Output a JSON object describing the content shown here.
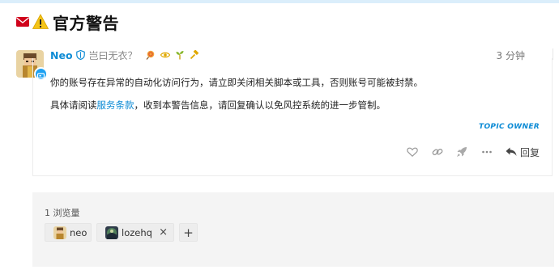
{
  "topic": {
    "title": "官方警告"
  },
  "post": {
    "username": "Neo",
    "user_title": "岂曰无衣？",
    "time": "3 分钟",
    "paragraph1": "你的账号存在异常的自动化访问行为，请立即关闭相关脚本或工具，否则账号可能被封禁。",
    "paragraph2_before": "具体请阅读",
    "tos_link": "服务条款",
    "paragraph2_after": "，收到本警告信息，请回复确认以免风控系统的进一步管制。",
    "owner_badge": "TOPIC OWNER",
    "reply_label": "回复"
  },
  "views": {
    "label": "1 浏览量",
    "users": [
      {
        "name": "neo"
      },
      {
        "name": "lozehq"
      }
    ],
    "remove_symbol": "×",
    "add_symbol": "+"
  },
  "colors": {
    "accent": "#0d8bd5",
    "mail_red": "#d0021b",
    "warning_yellow": "#f5c518",
    "panel_bg": "#f4f4f4"
  },
  "icons": {
    "title": [
      "envelope-icon",
      "warning-icon"
    ],
    "badges": [
      "lollipop-icon",
      "eye-icon",
      "sprout-icon",
      "hammer-icon"
    ],
    "actions": [
      "heart-icon",
      "link-icon",
      "rocket-icon",
      "ellipsis-icon",
      "reply-icon"
    ]
  }
}
